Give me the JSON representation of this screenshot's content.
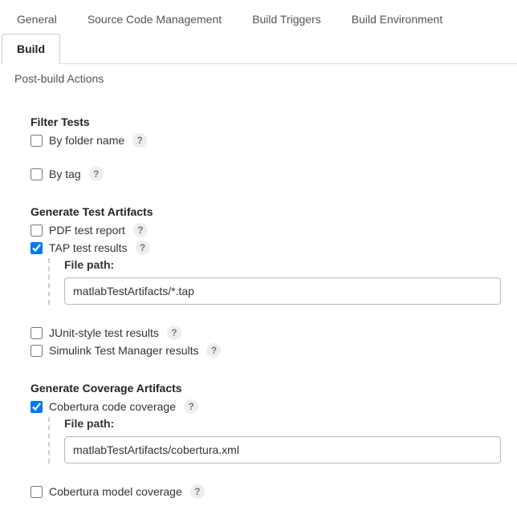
{
  "tabs": {
    "general": "General",
    "scm": "Source Code Management",
    "triggers": "Build Triggers",
    "env": "Build Environment",
    "build": "Build",
    "post": "Post-build Actions"
  },
  "filterTests": {
    "heading": "Filter Tests",
    "byFolder": "By folder name",
    "byTag": "By tag"
  },
  "genTest": {
    "heading": "Generate Test Artifacts",
    "pdf": "PDF test report",
    "tap": "TAP test results",
    "filePathLabel": "File path:",
    "tapValue": "matlabTestArtifacts/*.tap",
    "junit": "JUnit-style test results",
    "simulink": "Simulink Test Manager results"
  },
  "genCov": {
    "heading": "Generate Coverage Artifacts",
    "coberturaCode": "Cobertura code coverage",
    "filePathLabel": "File path:",
    "coberturaValue": "matlabTestArtifacts/cobertura.xml",
    "coberturaModel": "Cobertura model coverage"
  },
  "help": "?"
}
